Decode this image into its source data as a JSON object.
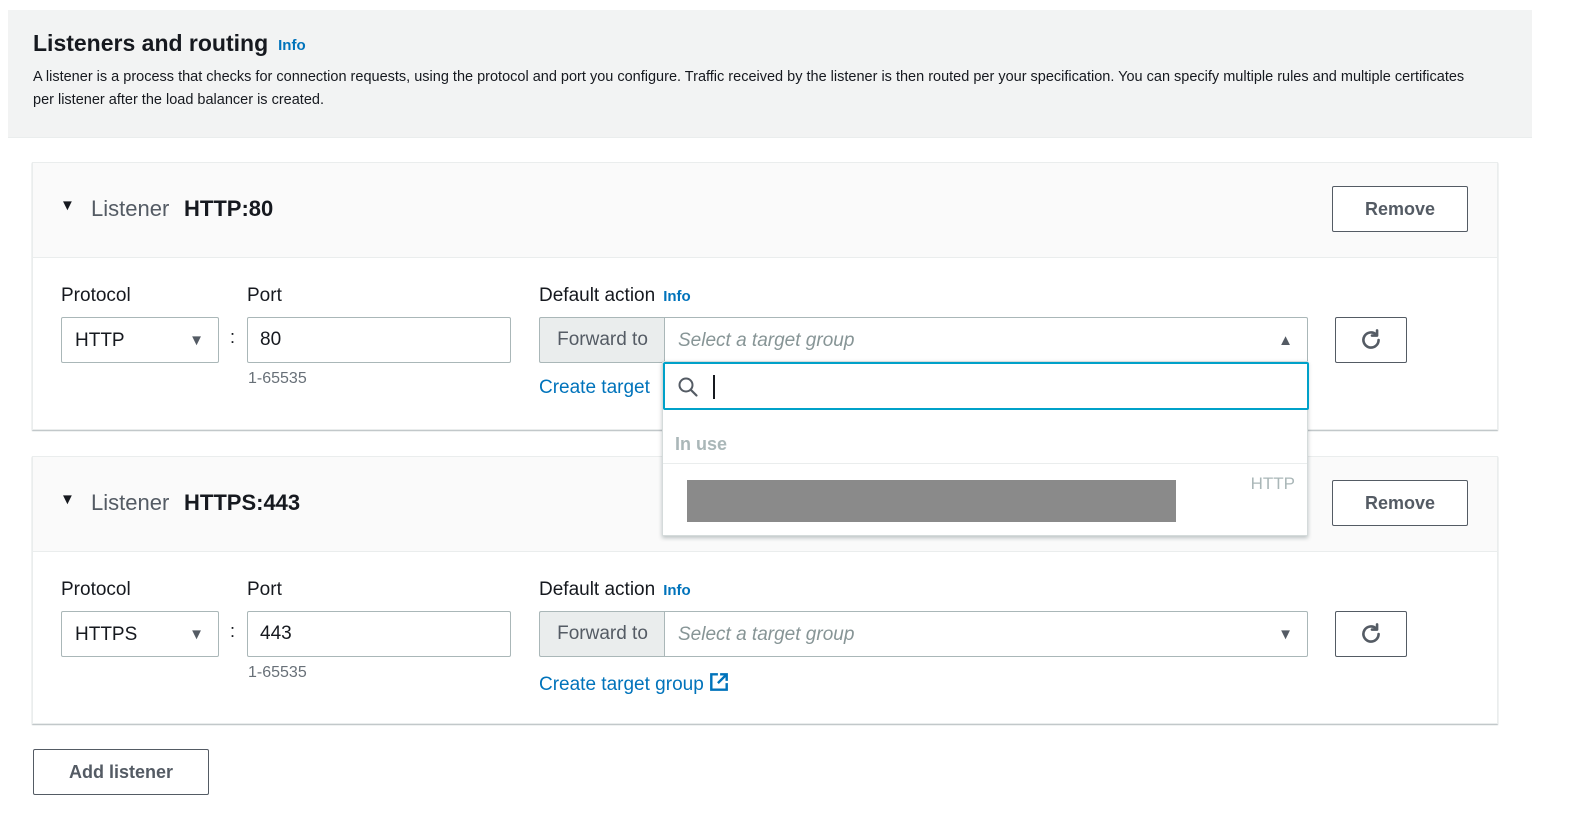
{
  "section": {
    "title": "Listeners and routing",
    "info": "Info",
    "description": "A listener is a process that checks for connection requests, using the protocol and port you configure. Traffic received by the listener is then routed per your specification. You can specify multiple rules and multiple certificates per listener after the load balancer is created."
  },
  "listeners": [
    {
      "label": "Listener",
      "name": "HTTP:80",
      "remove_label": "Remove",
      "protocol_label": "Protocol",
      "protocol_value": "HTTP",
      "port_label": "Port",
      "port_value": "80",
      "port_hint": "1-65535",
      "action_label": "Default action",
      "action_info": "Info",
      "forward_label": "Forward to",
      "target_placeholder": "Select a target group",
      "create_link": "Create target"
    },
    {
      "label": "Listener",
      "name": "HTTPS:443",
      "remove_label": "Remove",
      "protocol_label": "Protocol",
      "protocol_value": "HTTPS",
      "port_label": "Port",
      "port_value": "443",
      "port_hint": "1-65535",
      "action_label": "Default action",
      "action_info": "Info",
      "forward_label": "Forward to",
      "target_placeholder": "Select a target group",
      "create_link": "Create target group"
    }
  ],
  "dropdown": {
    "group_label": "In use",
    "option_protocol": "HTTP"
  },
  "add_listener_label": "Add listener",
  "icons": [
    "caret-down-icon",
    "caret-up-icon",
    "refresh-icon",
    "external-link-icon",
    "search-icon"
  ],
  "colors": {
    "link": "#0073bb",
    "focus": "#00a1c9",
    "border": "#aab7b8"
  }
}
